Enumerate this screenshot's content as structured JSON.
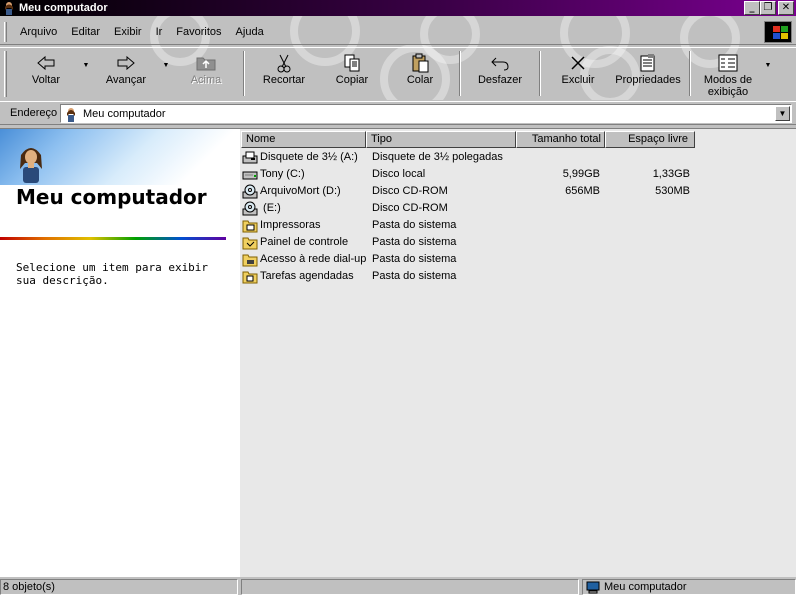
{
  "window": {
    "title": "Meu computador",
    "controls": [
      "minimize-icon",
      "restore-icon",
      "close-icon"
    ]
  },
  "menu": [
    {
      "label": "Arquivo",
      "accel": "A"
    },
    {
      "label": "Editar",
      "accel": "E"
    },
    {
      "label": "Exibir",
      "accel": "x"
    },
    {
      "label": "Ir",
      "accel": "I"
    },
    {
      "label": "Favoritos",
      "accel": "F"
    },
    {
      "label": "Ajuda",
      "accel": "j"
    }
  ],
  "toolbar": {
    "back": "Voltar",
    "forward": "Avançar",
    "up": "Acima",
    "cut": "Recortar",
    "copy": "Copiar",
    "paste": "Colar",
    "undo": "Desfazer",
    "delete": "Excluir",
    "properties": "Propriedades",
    "views_line1": "Modos de",
    "views_line2": "exibição"
  },
  "address": {
    "label": "Endereço",
    "value": "Meu computador"
  },
  "left_pane": {
    "title": "Meu computador",
    "description": "Selecione um item para exibir sua descrição."
  },
  "columns": [
    "Nome",
    "Tipo",
    "Tamanho total",
    "Espaço livre"
  ],
  "items": [
    {
      "name": "Disquete de 3½ (A:)",
      "type": "Disquete de 3½ polegadas",
      "total": "",
      "free": "",
      "icon": "floppy-drive-icon"
    },
    {
      "name": "Tony (C:)",
      "type": "Disco local",
      "total": "5,99GB",
      "free": "1,33GB",
      "icon": "hard-drive-icon"
    },
    {
      "name": "ArquivoMort (D:)",
      "type": "Disco CD-ROM",
      "total": "656MB",
      "free": "530MB",
      "icon": "cdrom-drive-icon"
    },
    {
      "name": " (E:)",
      "type": "Disco CD-ROM",
      "total": "",
      "free": "",
      "icon": "cdrom-drive-icon"
    },
    {
      "name": "Impressoras",
      "type": "Pasta do sistema",
      "total": "",
      "free": "",
      "icon": "printers-folder-icon"
    },
    {
      "name": "Painel de controle",
      "type": "Pasta do sistema",
      "total": "",
      "free": "",
      "icon": "control-panel-folder-icon"
    },
    {
      "name": "Acesso à rede dial-up",
      "type": "Pasta do sistema",
      "total": "",
      "free": "",
      "icon": "dialup-folder-icon"
    },
    {
      "name": "Tarefas agendadas",
      "type": "Pasta do sistema",
      "total": "",
      "free": "",
      "icon": "scheduled-tasks-folder-icon"
    }
  ],
  "status": {
    "count": "8 objeto(s)",
    "location": "Meu computador"
  },
  "colors": {
    "title_bar_start": "#000000",
    "title_bar_end": "#7a0090",
    "list_background": "#e8e8e8",
    "face": "#c0c0c0"
  }
}
